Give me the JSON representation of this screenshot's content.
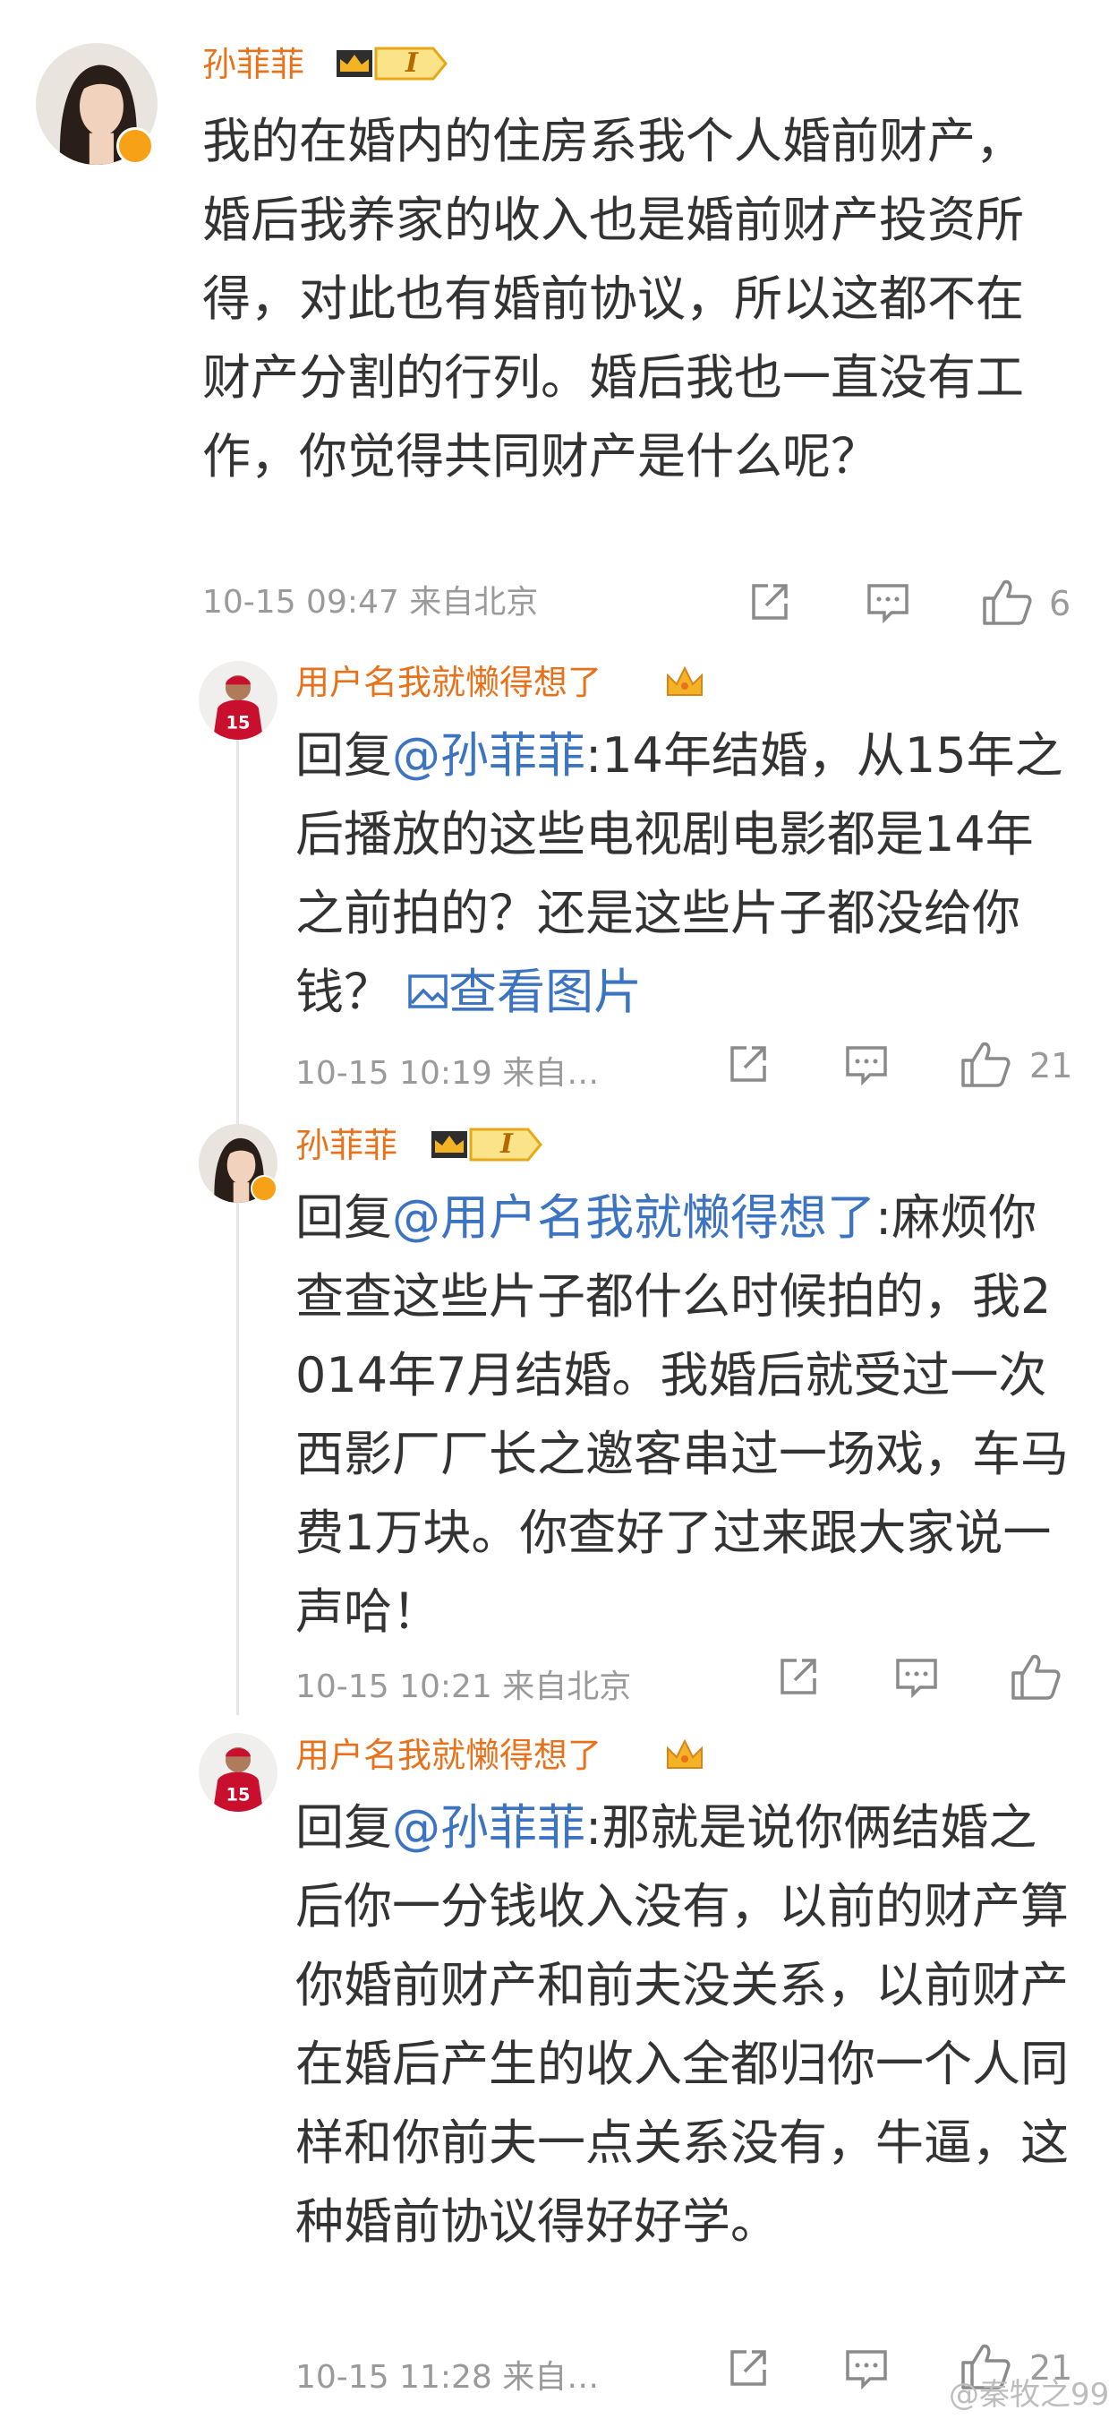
{
  "main_comment": {
    "username": "孙菲菲",
    "vip_label": "I",
    "text": "我的在婚内的住房系我个人婚前财产，婚后我养家的收入也是婚前财产投资所得，对此也有婚前协议，所以这都不在财产分割的行列。婚后我也一直没有工作，你觉得共同财产是什么呢？",
    "time": "10-15 09:47",
    "source": "来自北京",
    "likes": "6"
  },
  "replies": [
    {
      "username": "用户名我就懒得想了",
      "reply_prefix": "回复",
      "mention": "@孙菲菲",
      "text": ":14年结婚，从15年之后播放的这些电视剧电影都是14年之前拍的？还是这些片子都没给你钱？",
      "view_image": "查看图片",
      "time": "10-15 10:19",
      "source": "来自…",
      "likes": "21"
    },
    {
      "username": "孙菲菲",
      "vip_label": "I",
      "reply_prefix": "回复",
      "mention": "@用户名我就懒得想了",
      "text": ":麻烦你查查这些片子都什么时候拍的，我2014年7月结婚。我婚后就受过一次西影厂厂长之邀客串过一场戏，车马费1万块。你查好了过来跟大家说一声哈！",
      "time": "10-15 10:21",
      "source": "来自北京",
      "likes": ""
    },
    {
      "username": "用户名我就懒得想了",
      "reply_prefix": "回复",
      "mention": "@孙菲菲",
      "text": ":那就是说你俩结婚之后你一分钱收入没有，以前的财产算你婚前财产和前夫没关系，以前财产在婚后产生的收入全都归你一个人同样和你前夫一点关系没有，牛逼，这种婚前协议得好好学。",
      "time": "10-15 11:28",
      "source": "来自…",
      "likes": "21"
    }
  ],
  "watermark": "@秦牧之99",
  "colors": {
    "username": "#e8721c",
    "mention": "#3c74c1",
    "meta": "#9a9a9a",
    "vip_gold": "#f4b325",
    "verified": "#f7a116"
  },
  "icons": [
    "repost-icon",
    "comment-icon",
    "like-icon",
    "crown-vip-icon",
    "crown-icon",
    "image-icon",
    "verified-badge-icon"
  ]
}
